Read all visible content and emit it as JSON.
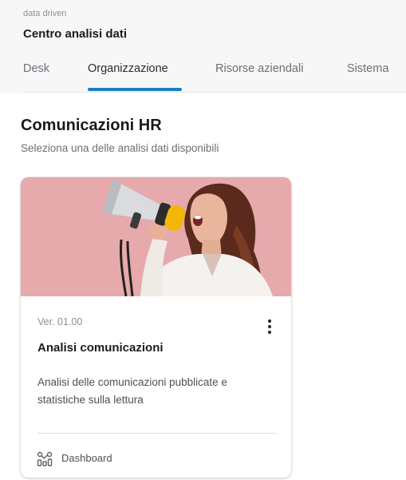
{
  "header": {
    "kicker": "data driven",
    "app_title": "Centro analisi dati",
    "tabs": [
      {
        "label": "Desk",
        "active": false
      },
      {
        "label": "Organizzazione",
        "active": true
      },
      {
        "label": "Risorse aziendali",
        "active": false
      },
      {
        "label": "Sistema",
        "active": false
      }
    ]
  },
  "section": {
    "title": "Comunicazioni HR",
    "subtitle": "Seleziona una delle analisi dati disponibili"
  },
  "card": {
    "image_subject": "megaphone-woman-image",
    "version": "Ver. 01.00",
    "title": "Analisi comunicazioni",
    "description": "Analisi delle comunicazioni pubblicate e statistiche sulla lettura",
    "footer_icon": "dashboard-icon",
    "footer_label": "Dashboard",
    "menu_icon": "more-vertical-icon"
  },
  "colors": {
    "accent": "#1a7fc1",
    "header_bg": "#f7f7f8",
    "image_bg": "#e5a8ab"
  }
}
